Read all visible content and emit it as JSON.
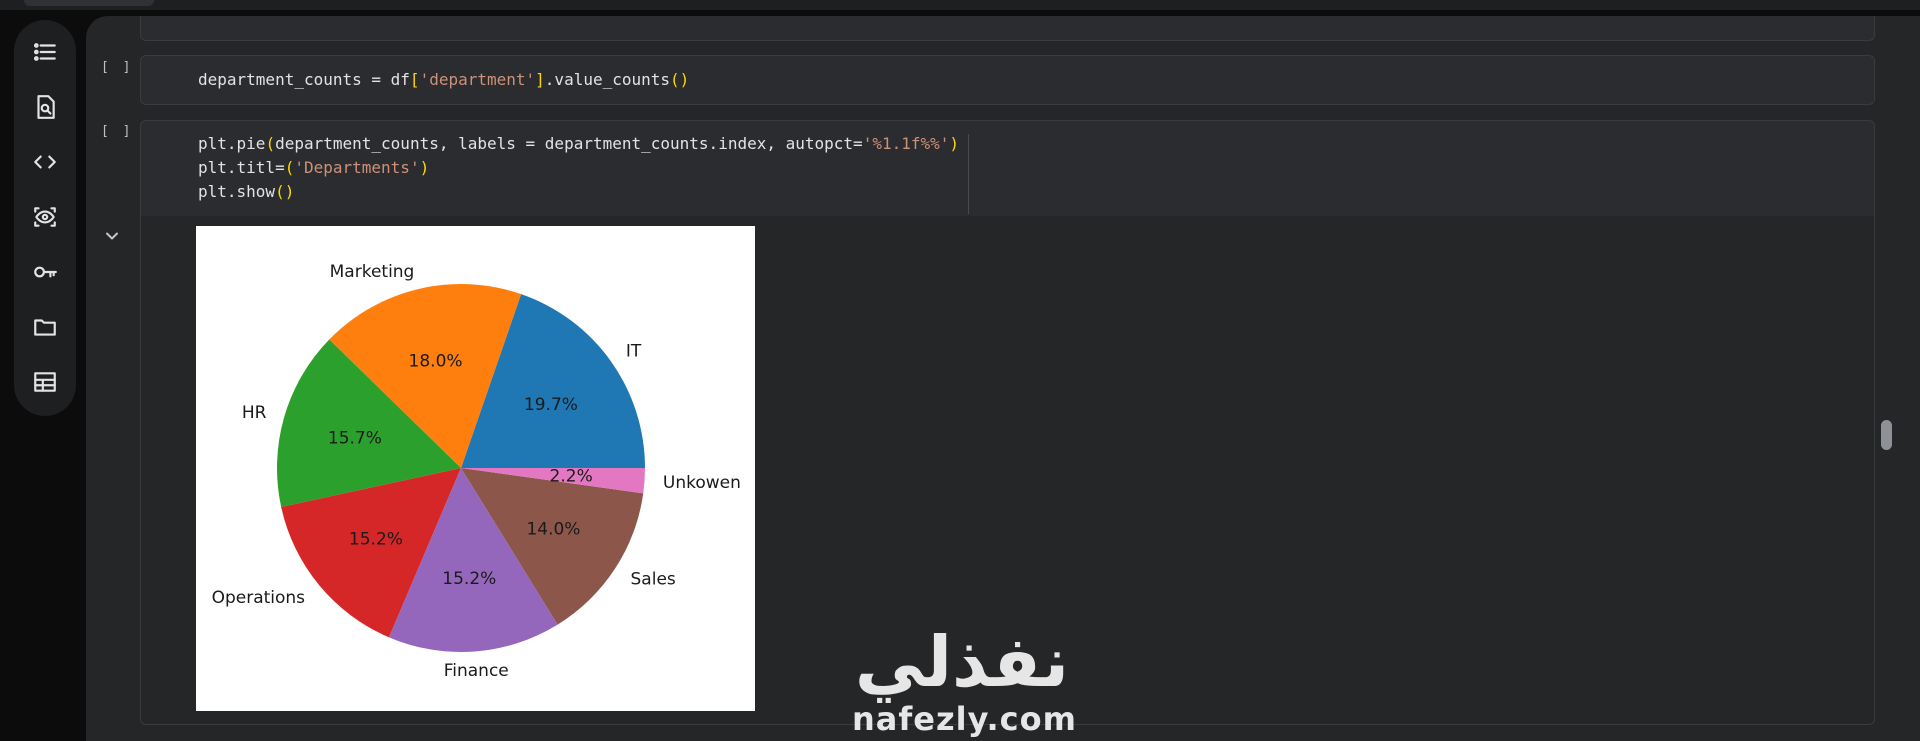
{
  "sidebar": {
    "items": [
      {
        "icon": "table-of-contents-icon"
      },
      {
        "icon": "find-in-page-icon"
      },
      {
        "icon": "code-snippets-icon"
      },
      {
        "icon": "variables-inspector-icon"
      },
      {
        "icon": "secrets-key-icon"
      },
      {
        "icon": "files-folder-icon"
      },
      {
        "icon": "data-table-icon"
      }
    ]
  },
  "cells": [
    {
      "run_label": "[ ]",
      "line": {
        "a": "department_counts = df",
        "b": "[",
        "c": "'department'",
        "d": "]",
        "e": ".value_counts",
        "f": "()"
      }
    },
    {
      "run_label": "[ ]",
      "line1": {
        "a": "plt.pie",
        "b": "(",
        "c": "department_counts, labels = department_counts.index, autopct=",
        "d": "'%1.1f%%'",
        "e": ")"
      },
      "line2": {
        "a": "plt.titl=",
        "b": "(",
        "c": "'Departments'",
        "d": ")"
      },
      "line3": {
        "a": "plt.show",
        "b": "()"
      }
    }
  ],
  "chart_data": {
    "type": "pie",
    "slices": [
      {
        "label": "IT",
        "value": 19.7,
        "pct_label": "19.7%",
        "color": "#1f77b4"
      },
      {
        "label": "Marketing",
        "value": 18.0,
        "pct_label": "18.0%",
        "color": "#ff7f0e"
      },
      {
        "label": "HR",
        "value": 15.7,
        "pct_label": "15.7%",
        "color": "#2ca02c"
      },
      {
        "label": "Operations",
        "value": 15.2,
        "pct_label": "15.2%",
        "color": "#d62728"
      },
      {
        "label": "Finance",
        "value": 15.2,
        "pct_label": "15.2%",
        "color": "#9467bd"
      },
      {
        "label": "Sales",
        "value": 14.0,
        "pct_label": "14.0%",
        "color": "#8c564b"
      },
      {
        "label": "Unkowen",
        "value": 2.2,
        "pct_label": "2.2%",
        "color": "#e377c2"
      }
    ],
    "start_angle": 0,
    "direction": "counterclockwise"
  },
  "watermark": {
    "arabic": "نفذلي",
    "latin": "nafezly.com"
  }
}
